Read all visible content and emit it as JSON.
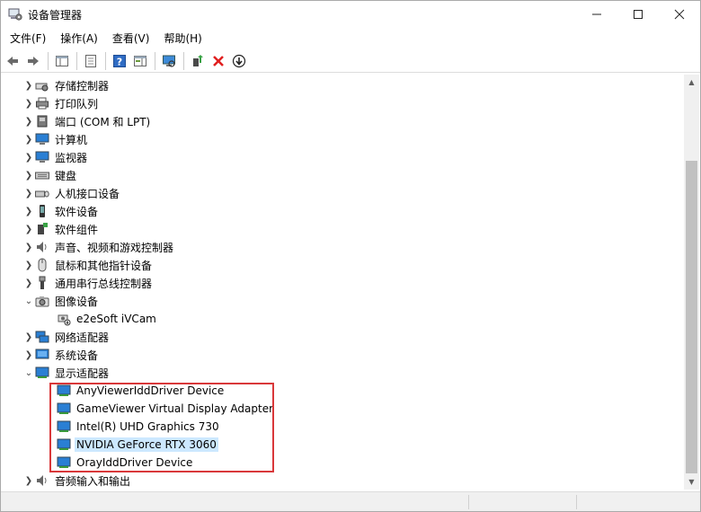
{
  "window": {
    "title": "设备管理器"
  },
  "menu": [
    {
      "label": "文件(F)"
    },
    {
      "label": "操作(A)"
    },
    {
      "label": "查看(V)"
    },
    {
      "label": "帮助(H)"
    }
  ],
  "toolbar": {
    "icons": [
      "back-icon",
      "forward-icon",
      "show-hide-tree-icon",
      "properties-icon",
      "help-icon",
      "action-pane-icon",
      "scan-hardware-icon",
      "update-driver-icon",
      "uninstall-icon",
      "disable-device-icon"
    ]
  },
  "tree": {
    "items": [
      {
        "label": "存储控制器",
        "expanded": false,
        "icon": "storage-controller-icon"
      },
      {
        "label": "打印队列",
        "expanded": false,
        "icon": "printer-icon"
      },
      {
        "label": "端口 (COM 和 LPT)",
        "expanded": false,
        "icon": "port-icon"
      },
      {
        "label": "计算机",
        "expanded": false,
        "icon": "computer-icon"
      },
      {
        "label": "监视器",
        "expanded": false,
        "icon": "monitor-icon"
      },
      {
        "label": "键盘",
        "expanded": false,
        "icon": "keyboard-icon"
      },
      {
        "label": "人机接口设备",
        "expanded": false,
        "icon": "hid-icon"
      },
      {
        "label": "软件设备",
        "expanded": false,
        "icon": "software-device-icon"
      },
      {
        "label": "软件组件",
        "expanded": false,
        "icon": "software-component-icon"
      },
      {
        "label": "声音、视频和游戏控制器",
        "expanded": false,
        "icon": "sound-icon"
      },
      {
        "label": "鼠标和其他指针设备",
        "expanded": false,
        "icon": "mouse-icon"
      },
      {
        "label": "通用串行总线控制器",
        "expanded": false,
        "icon": "usb-icon"
      },
      {
        "label": "图像设备",
        "expanded": true,
        "icon": "camera-icon"
      },
      {
        "label": "e2eSoft iVCam",
        "child": true,
        "icon": "webcam-icon"
      },
      {
        "label": "网络适配器",
        "expanded": false,
        "icon": "network-adapter-icon"
      },
      {
        "label": "系统设备",
        "expanded": false,
        "icon": "system-device-icon"
      },
      {
        "label": "显示适配器",
        "expanded": true,
        "icon": "display-adapter-icon"
      },
      {
        "label": "AnyViewerIddDriver Device",
        "child": true,
        "icon": "display-adapter-icon"
      },
      {
        "label": "GameViewer Virtual Display Adapter",
        "child": true,
        "icon": "display-adapter-icon"
      },
      {
        "label": "Intel(R) UHD Graphics 730",
        "child": true,
        "icon": "display-adapter-icon"
      },
      {
        "label": "NVIDIA GeForce RTX 3060",
        "child": true,
        "selected": true,
        "icon": "display-adapter-icon"
      },
      {
        "label": "OrayIddDriver Device",
        "child": true,
        "icon": "display-adapter-icon"
      },
      {
        "label": "音频输入和输出",
        "expanded": false,
        "icon": "audio-io-icon"
      }
    ]
  },
  "colors": {
    "selection": "#cce8ff",
    "highlight_border": "#d9383a",
    "monitor_blue": "#2a7fd4"
  }
}
